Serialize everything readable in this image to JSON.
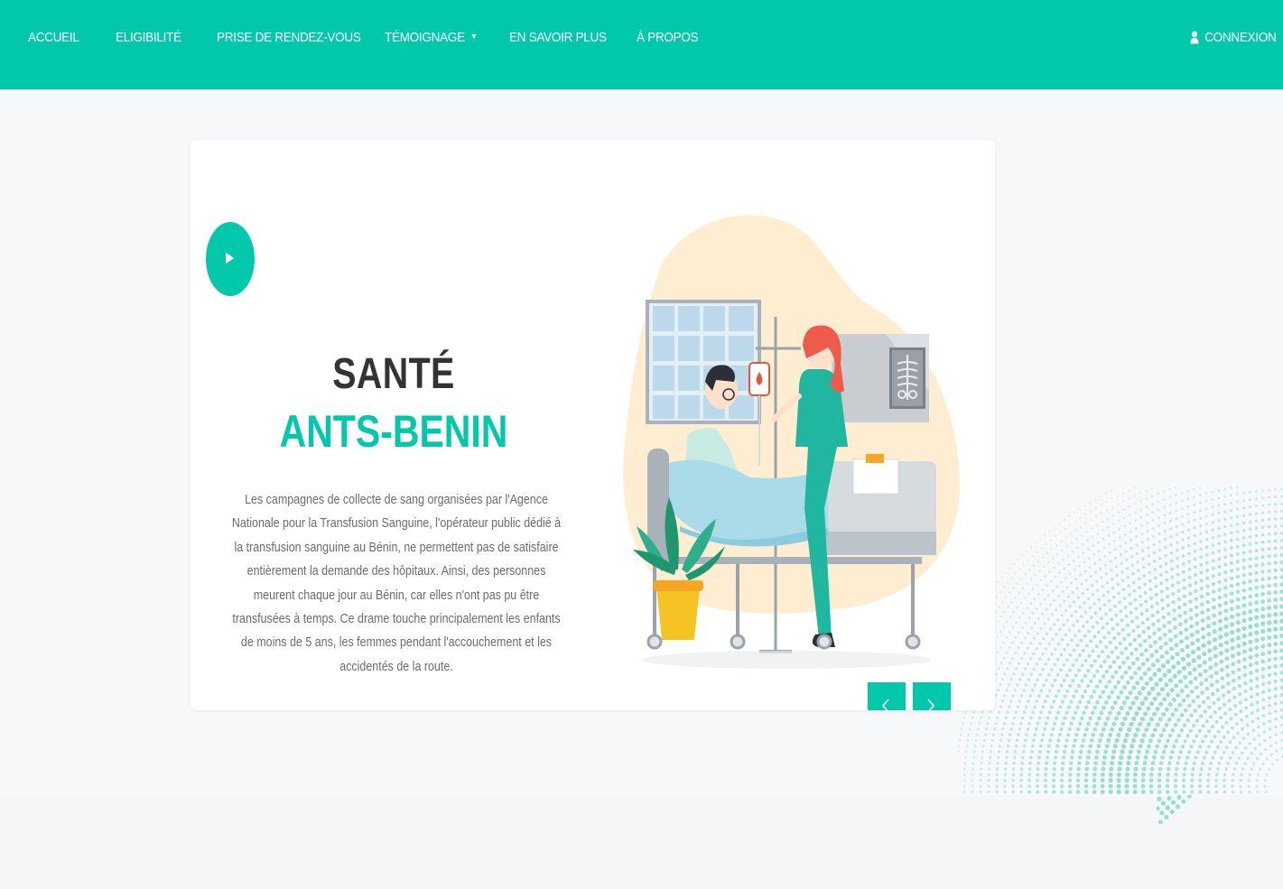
{
  "nav": {
    "items": [
      {
        "label": "ACCUEIL"
      },
      {
        "label": "ELIGIBILITÉ"
      },
      {
        "label": "PRISE DE RENDEZ-VOUS"
      },
      {
        "label": "TÉMOIGNAGE"
      },
      {
        "label": "EN SAVOIR PLUS"
      },
      {
        "label": "À PROPOS"
      }
    ],
    "login_label": "CONNEXION"
  },
  "hero": {
    "title_line1": "SANTÉ",
    "title_line2": "ANTS-BENIN",
    "description": "Les campagnes de collecte de sang organisées par l'Agence Nationale pour la Transfusion Sanguine, l'opérateur public dédié à la transfusion sanguine au Bénin, ne permettent pas de satisfaire entièrement la demande des hôpitaux. Ainsi, des personnes meurent chaque jour au Bénin, car elles n'ont pas pu être transfusées à temps. Ce drame touche principalement les enfants de moins de 5 ans, les femmes pendant l'accouchement et les accidentés de la route."
  },
  "icons": {
    "play": "play-icon",
    "user": "user-icon",
    "caret": "caret-down-icon",
    "prev": "chevron-left-icon",
    "next": "chevron-right-icon"
  },
  "colors": {
    "accent": "#01c8aa",
    "title_dark": "#333333",
    "text": "#6b6b6b",
    "background": "#f7f8f9"
  }
}
